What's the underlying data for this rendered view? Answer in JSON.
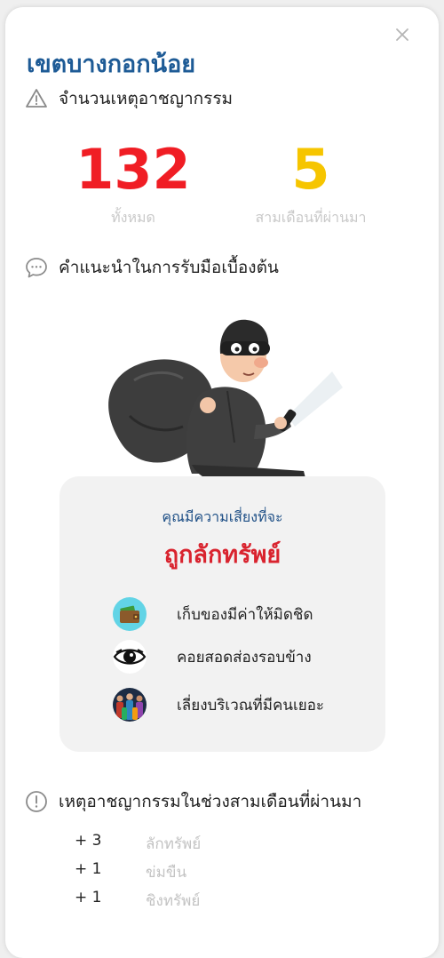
{
  "area_title": "เขตบางกอกน้อย",
  "crime_count": {
    "heading": "จำนวนเหตุอาชญากรรม",
    "total_value": "132",
    "total_label": "ทั้งหมด",
    "recent_value": "5",
    "recent_label": "สามเดือนที่ผ่านมา",
    "colors": {
      "total": "#f01d24",
      "recent": "#f6c500"
    }
  },
  "advice": {
    "heading": "คำแนะนำในการรับมือเบื้องต้น",
    "risk_prefix": "คุณมีความเสี่ยงที่จะ",
    "risk_type": "ถูกลักทรัพย์",
    "tips": [
      {
        "icon": "wallet-icon",
        "label": "เก็บของมีค่าให้มิดชิด"
      },
      {
        "icon": "eye-icon",
        "label": "คอยสอดส่องรอบข้าง"
      },
      {
        "icon": "crowd-icon",
        "label": "เลี่ยงบริเวณที่มีคนเยอะ"
      }
    ]
  },
  "recent_crimes": {
    "heading": "เหตุอาชญากรรมในช่วงสามเดือนที่ผ่านมา",
    "items": [
      {
        "count": "+ 3",
        "label": "ลักทรัพย์"
      },
      {
        "count": "+ 1",
        "label": "ข่มขืน"
      },
      {
        "count": "+ 1",
        "label": "ชิงทรัพย์"
      }
    ]
  }
}
